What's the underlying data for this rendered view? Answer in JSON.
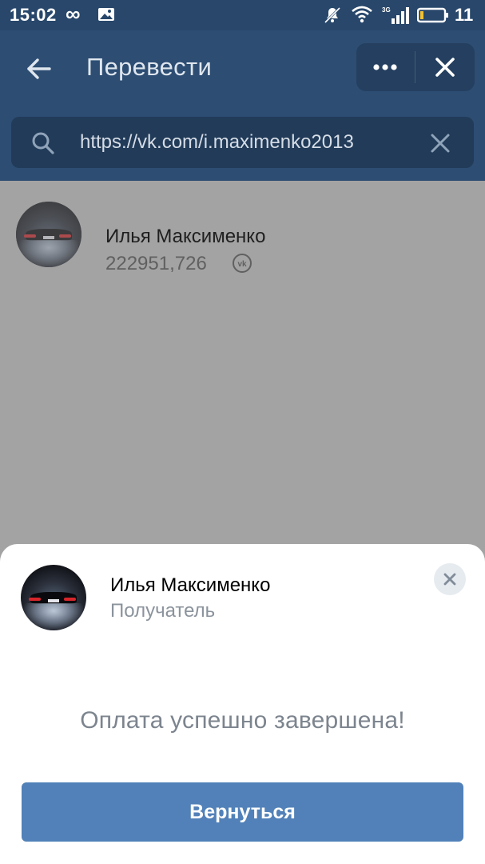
{
  "status_bar": {
    "time": "15:02",
    "loop_glyph": "∞",
    "battery_percent": "11",
    "network_type": "3G",
    "icons": [
      "infinity-icon",
      "image-icon",
      "notifications-muted-icon",
      "wifi-icon",
      "signal-icon",
      "battery-icon"
    ]
  },
  "header": {
    "title": "Перевести",
    "back_icon": "arrow-left-icon",
    "more_icon": "more-horizontal-icon",
    "close_icon": "close-icon"
  },
  "search": {
    "value": "https://vk.com/i.maximenko2013",
    "search_icon": "search-icon",
    "clear_icon": "clear-icon"
  },
  "result": {
    "name": "Илья Максименко",
    "amount": "222951,726",
    "badge_icon": "vk-logo-icon"
  },
  "sheet": {
    "name": "Илья Максименко",
    "role": "Получатель",
    "message": "Оплата успешно завершена!",
    "button_label": "Вернуться",
    "close_icon": "close-icon"
  },
  "colors": {
    "status_bar": "#28476b",
    "header": "#2d4d73",
    "search_box": "#213b59",
    "dim_background": "#a3a3a3",
    "button": "#5181b8",
    "muted_text": "#7c848e"
  }
}
